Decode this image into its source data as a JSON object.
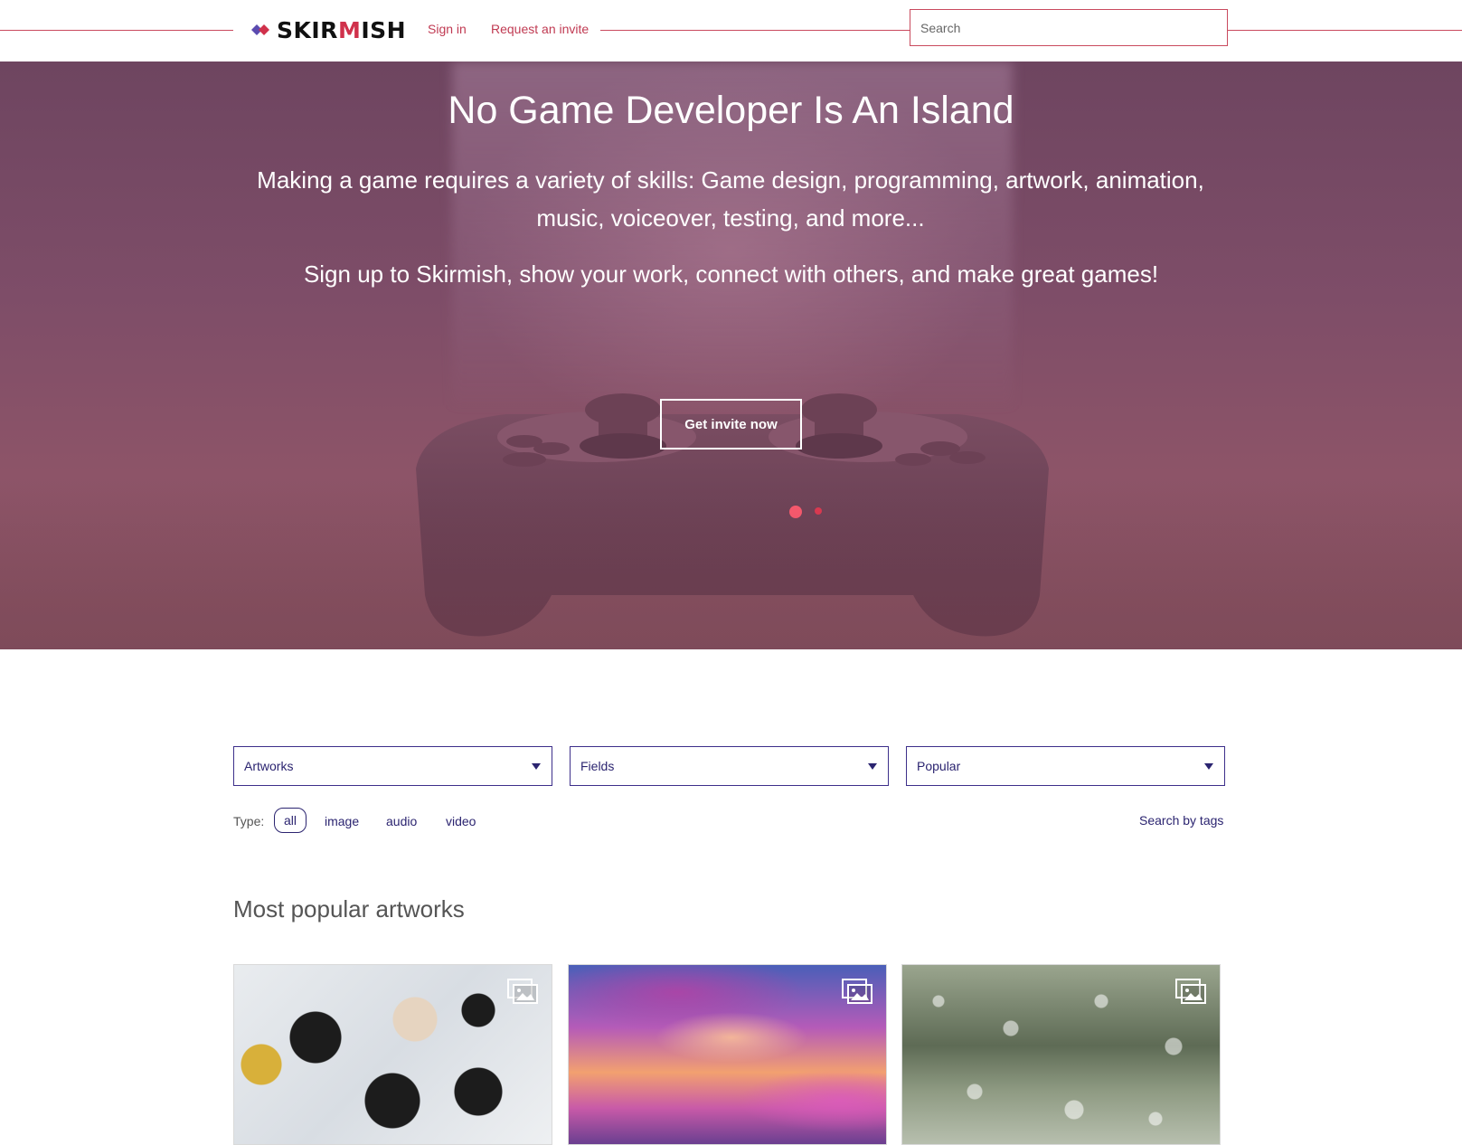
{
  "header": {
    "logo_prefix": "SKIR",
    "logo_m": "M",
    "logo_suffix": "ISH",
    "nav": {
      "sign_in": "Sign in",
      "request_invite": "Request an invite"
    },
    "search_placeholder": "Search"
  },
  "hero": {
    "title": "No Game Developer Is An Island",
    "subtitle": "Making a game requires a variety of skills: Game design, programming, artwork, animation, music, voiceover, testing, and more...",
    "tagline": "Sign up to Skirmish, show your work, connect with others, and make great games!",
    "cta_label": "Get invite now"
  },
  "filters": {
    "category": "Artworks",
    "fields": "Fields",
    "sort": "Popular",
    "type_label": "Type:",
    "types": [
      "all",
      "image",
      "audio",
      "video"
    ],
    "selected_type": "all",
    "search_by_tags": "Search by tags"
  },
  "gallery": {
    "title": "Most popular artworks",
    "cards": [
      {
        "media_icon": "image-stack-icon"
      },
      {
        "media_icon": "image-stack-icon"
      },
      {
        "media_icon": "image-stack-icon"
      }
    ]
  },
  "colors": {
    "brand_red": "#c94a5e",
    "brand_indigo": "#2b2470",
    "hero_overlay": "#7e4d68"
  }
}
